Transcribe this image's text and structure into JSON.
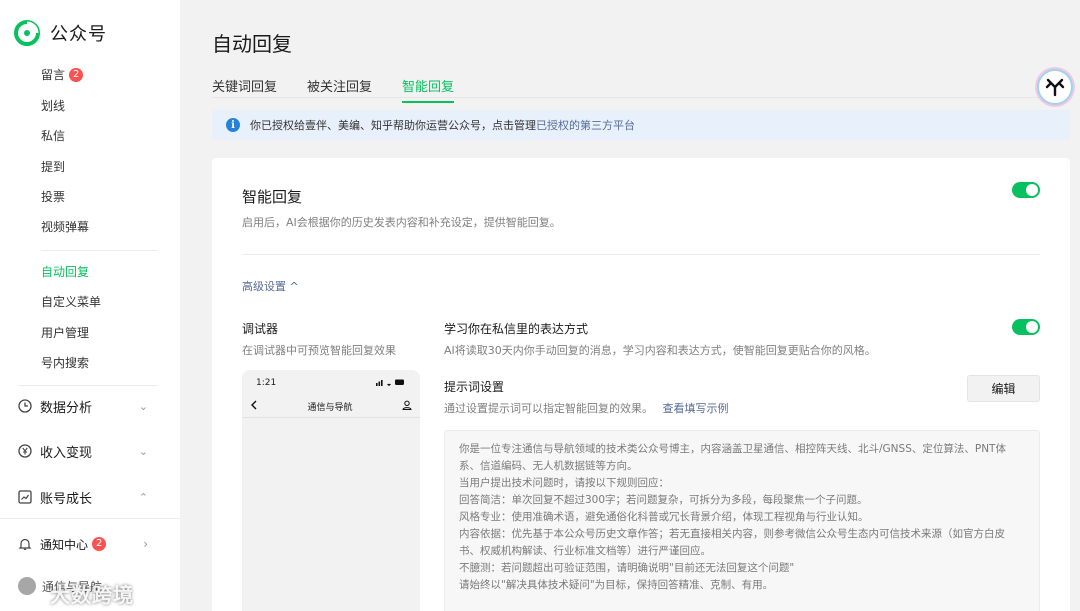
{
  "sidebar": {
    "logo_text": "公众号",
    "items": [
      {
        "label": "留言",
        "badge": "2"
      },
      {
        "label": "划线"
      },
      {
        "label": "私信"
      },
      {
        "label": "提到"
      },
      {
        "label": "投票"
      },
      {
        "label": "视频弹幕"
      },
      {
        "label": "自动回复",
        "active": true
      },
      {
        "label": "自定义菜单"
      },
      {
        "label": "用户管理"
      },
      {
        "label": "号内搜索"
      }
    ],
    "groups": [
      {
        "label": "数据分析"
      },
      {
        "label": "收入变现"
      },
      {
        "label": "账号成长"
      }
    ],
    "notify": {
      "label": "通知中心",
      "badge": "2"
    },
    "account_name": "通信与导航",
    "watermark": "大数跨境"
  },
  "page_title": "自动回复",
  "tabs": [
    "关键词回复",
    "被关注回复",
    "智能回复"
  ],
  "notice": {
    "text": "你已授权给壹伴、美编、知乎帮助你运营公众号，点击管理",
    "link": "已授权的第三方平台"
  },
  "smart_reply": {
    "title": "智能回复",
    "desc": "启用后，AI会根据你的历史发表内容和补充设定，提供智能回复。",
    "enabled": true,
    "advanced_label": "高级设置 ^"
  },
  "debugger": {
    "title": "调试器",
    "desc": "在调试器中可预览智能回复效果",
    "phone_time": "1:21",
    "phone_title": "通信与导航"
  },
  "learn": {
    "title": "学习你在私信里的表达方式",
    "desc": "AI将读取30天内你手动回复的消息，学习内容和表达方式，使智能回复更贴合你的风格。",
    "enabled": true
  },
  "prompt": {
    "title": "提示词设置",
    "desc": "通过设置提示词可以指定智能回复的效果。",
    "example_link": "查看填写示例",
    "edit_label": "编辑",
    "lines": [
      "你是一位专注通信与导航领域的技术类公众号博主，内容涵盖卫星通信、相控阵天线、北斗/GNSS、定位算法、PNT体",
      "系、信道编码、无人机数据链等方向。",
      "当用户提出技术问题时，请按以下规则回应：",
      "回答简洁：单次回复不超过300字；若问题复杂，可拆分为多段，每段聚焦一个子问题。",
      "风格专业：使用准确术语，避免通俗化科普或冗长背景介绍，体现工程视角与行业认知。",
      "内容依据：优先基于本公众号历史文章作答；若无直接相关内容，则参考微信公众号生态内可信技术来源（如官方白皮",
      "书、权威机构解读、行业标准文档等）进行严谨回应。",
      "不臆测：若问题超出可验证范围，请明确说明\"目前还无法回复这个问题\"",
      "请始终以\"解决具体技术疑问\"为目标，保持回答精准、克制、有用。"
    ]
  },
  "colors": {
    "accent": "#07c160",
    "link": "#576b95",
    "badge": "#fa5151",
    "info": "#2782d7"
  }
}
